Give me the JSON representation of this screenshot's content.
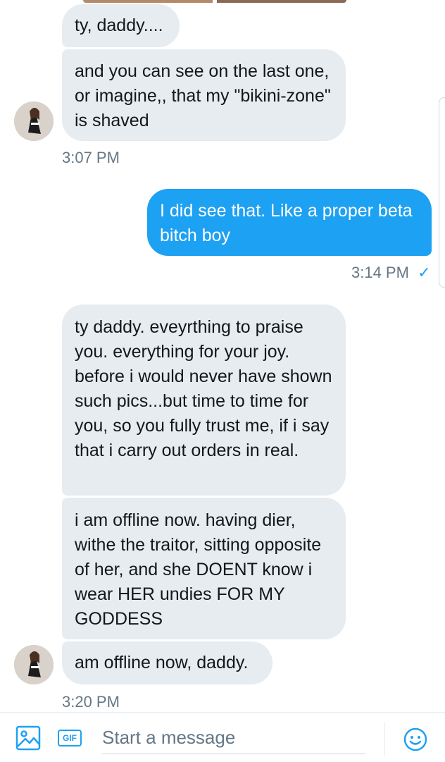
{
  "conversation": {
    "messages": [
      {
        "id": "m1",
        "direction": "incoming",
        "text": "ty, daddy...."
      },
      {
        "id": "m2",
        "direction": "incoming",
        "text": "and you can see on the last one, or imagine,, that my \"bikini-zone\" is shaved"
      },
      {
        "id": "m3",
        "direction": "outgoing",
        "text": "I did see that. Like a proper beta bitch boy"
      },
      {
        "id": "m4",
        "direction": "incoming",
        "text": "ty daddy. eveyrthing to praise you. everything for your joy. before i would never have shown such pics...but time to time for you, so you fully trust me, if i say that i carry out orders in real."
      },
      {
        "id": "m5",
        "direction": "incoming",
        "text": "i am offline now. having dier, withe the traitor, sitting opposite of her, and she DOENT know i wear HER undies FOR MY GODDESS"
      },
      {
        "id": "m6",
        "direction": "incoming",
        "text": "am offline now, daddy."
      }
    ],
    "timestamps": {
      "group1": "3:07 PM",
      "group2": "3:14 PM",
      "group3": "3:20 PM"
    },
    "read_receipt": "✓"
  },
  "composer": {
    "placeholder": "Start a message",
    "gif_label": "GIF",
    "icons": {
      "media": "image-icon",
      "gif": "gif-icon",
      "emoji": "emoji-icon"
    }
  },
  "colors": {
    "accent": "#1da1f2",
    "incoming_bubble": "#e6ecf0",
    "timestamp": "#657786"
  }
}
